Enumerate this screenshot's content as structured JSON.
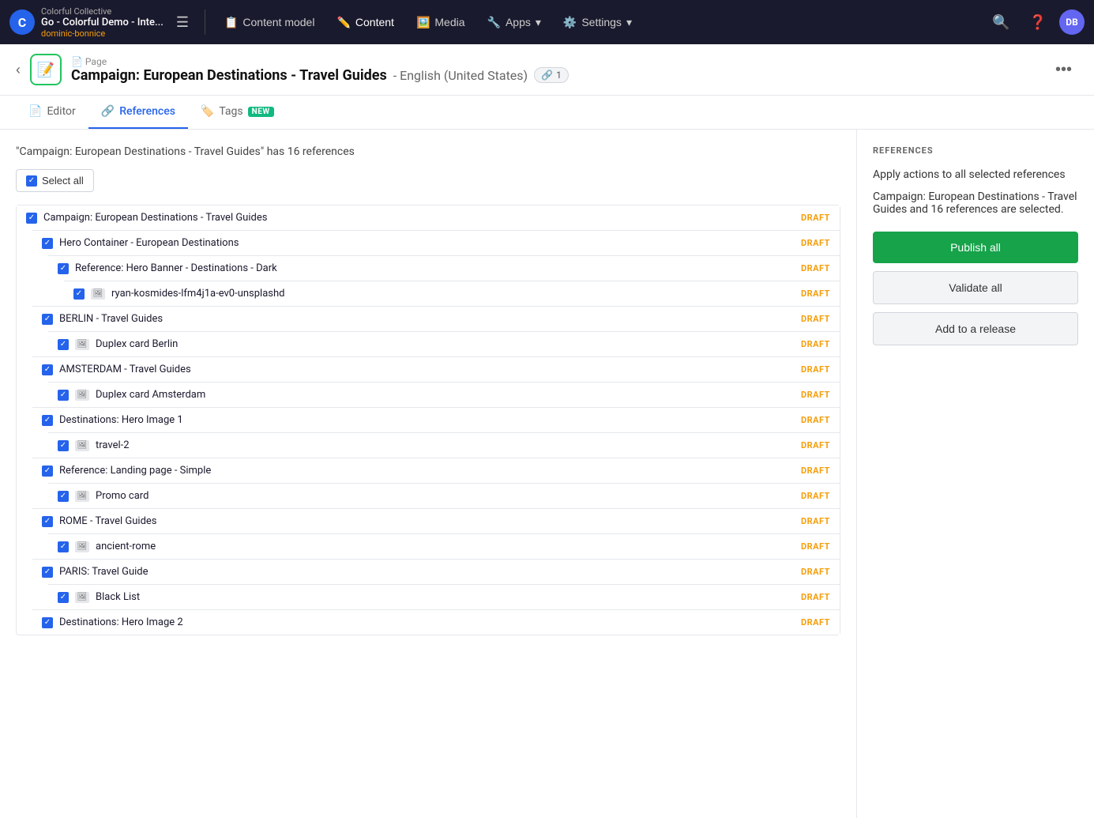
{
  "nav": {
    "org": "Colorful Collective",
    "project": "Go - Colorful Demo - Inte...",
    "user": "dominic-bonnice",
    "logo_letter": "C",
    "items": [
      {
        "id": "content-model",
        "label": "Content model",
        "icon": "📋"
      },
      {
        "id": "content",
        "label": "Content",
        "icon": "✏️"
      },
      {
        "id": "media",
        "label": "Media",
        "icon": "🖼️"
      },
      {
        "id": "apps",
        "label": "Apps",
        "icon": "🔧",
        "has_dropdown": true
      },
      {
        "id": "settings",
        "label": "Settings",
        "icon": "⚙️",
        "has_dropdown": true
      }
    ],
    "avatar_initials": "DB"
  },
  "entry": {
    "breadcrumb": "📄 Page",
    "title": "Campaign: European Destinations - Travel Guides",
    "locale": "- English (United States)",
    "refs_count": "1"
  },
  "tabs": [
    {
      "id": "editor",
      "label": "Editor",
      "active": false
    },
    {
      "id": "references",
      "label": "References",
      "active": true
    },
    {
      "id": "tags",
      "label": "Tags",
      "active": false,
      "badge": "NEW"
    }
  ],
  "references_panel": {
    "count_text": "\"Campaign: European Destinations - Travel Guides\" has 16 references",
    "select_all_label": "Select all",
    "items": [
      {
        "id": "campaign-root",
        "name": "Campaign: European Destinations - Travel Guides",
        "status": "DRAFT",
        "checked": true,
        "is_image": false,
        "children": [
          {
            "id": "hero-container",
            "name": "Hero Container - European Destinations",
            "status": "DRAFT",
            "checked": true,
            "is_image": false,
            "children": [
              {
                "id": "ref-hero-banner",
                "name": "Reference: Hero Banner - Destinations - Dark",
                "status": "DRAFT",
                "checked": true,
                "is_image": false,
                "children": [
                  {
                    "id": "ryan-kosmides",
                    "name": "ryan-kosmides-lfm4j1a-ev0-unsplashd",
                    "status": "DRAFT",
                    "checked": true,
                    "is_image": true,
                    "children": []
                  }
                ]
              }
            ]
          },
          {
            "id": "berlin-travel",
            "name": "BERLIN - Travel Guides",
            "status": "DRAFT",
            "checked": true,
            "is_image": false,
            "children": [
              {
                "id": "duplex-berlin",
                "name": "Duplex card Berlin",
                "status": "DRAFT",
                "checked": true,
                "is_image": true,
                "children": []
              }
            ]
          },
          {
            "id": "amsterdam-travel",
            "name": "AMSTERDAM - Travel Guides",
            "status": "DRAFT",
            "checked": true,
            "is_image": false,
            "children": [
              {
                "id": "duplex-amsterdam",
                "name": "Duplex card Amsterdam",
                "status": "DRAFT",
                "checked": true,
                "is_image": true,
                "children": []
              }
            ]
          },
          {
            "id": "destinations-hero-1",
            "name": "Destinations: Hero Image 1",
            "status": "DRAFT",
            "checked": true,
            "is_image": false,
            "children": [
              {
                "id": "travel-2",
                "name": "travel-2",
                "status": "DRAFT",
                "checked": true,
                "is_image": true,
                "children": []
              }
            ]
          },
          {
            "id": "ref-landing-simple",
            "name": "Reference: Landing page - Simple",
            "status": "DRAFT",
            "checked": true,
            "is_image": false,
            "children": [
              {
                "id": "promo-card",
                "name": "Promo card",
                "status": "DRAFT",
                "checked": true,
                "is_image": true,
                "children": []
              }
            ]
          },
          {
            "id": "rome-travel",
            "name": "ROME - Travel Guides",
            "status": "DRAFT",
            "checked": true,
            "is_image": false,
            "children": [
              {
                "id": "ancient-rome",
                "name": "ancient-rome",
                "status": "DRAFT",
                "checked": true,
                "is_image": true,
                "children": []
              }
            ]
          },
          {
            "id": "paris-travel",
            "name": "PARIS: Travel Guide",
            "status": "DRAFT",
            "checked": true,
            "is_image": false,
            "children": [
              {
                "id": "black-list",
                "name": "Black List",
                "status": "DRAFT",
                "checked": true,
                "is_image": true,
                "children": []
              }
            ]
          },
          {
            "id": "destinations-hero-2",
            "name": "Destinations: Hero Image 2",
            "status": "DRAFT",
            "checked": true,
            "is_image": false,
            "children": []
          }
        ]
      }
    ]
  },
  "sidebar": {
    "section_title": "REFERENCES",
    "apply_title": "Apply actions to all selected references",
    "selected_text": "Campaign: European Destinations - Travel Guides and 16 references are selected.",
    "btn_publish_all": "Publish all",
    "btn_validate_all": "Validate all",
    "btn_add_release": "Add to a release"
  }
}
